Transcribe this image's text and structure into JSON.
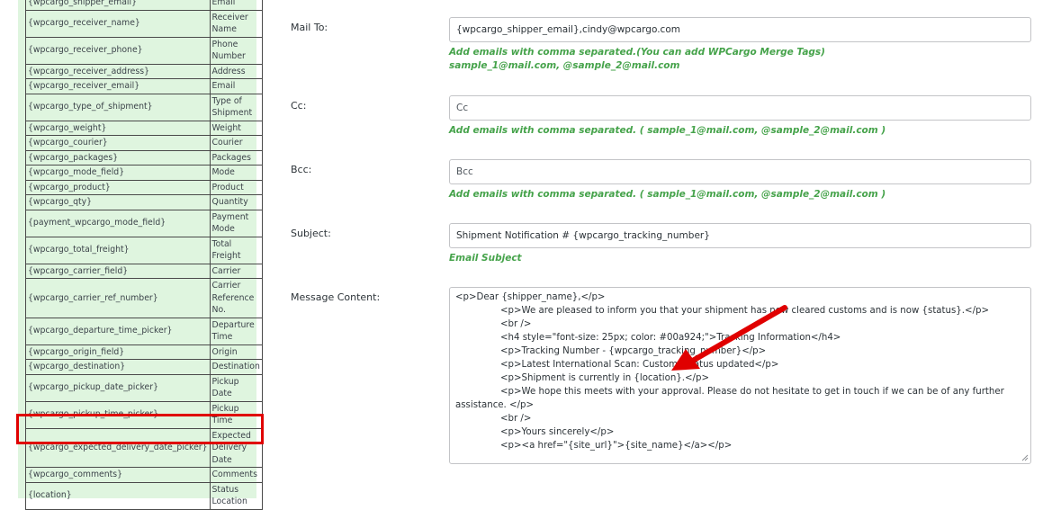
{
  "merge_tags": [
    {
      "tag": "{wpcargo_shipper_email}",
      "label": "Email"
    },
    {
      "tag": "{wpcargo_receiver_name}",
      "label": "Receiver Name"
    },
    {
      "tag": "{wpcargo_receiver_phone}",
      "label": "Phone Number"
    },
    {
      "tag": "{wpcargo_receiver_address}",
      "label": "Address"
    },
    {
      "tag": "{wpcargo_receiver_email}",
      "label": "Email"
    },
    {
      "tag": "{wpcargo_type_of_shipment}",
      "label": "Type of Shipment"
    },
    {
      "tag": "{wpcargo_weight}",
      "label": "Weight"
    },
    {
      "tag": "{wpcargo_courier}",
      "label": "Courier"
    },
    {
      "tag": "{wpcargo_packages}",
      "label": "Packages"
    },
    {
      "tag": "{wpcargo_mode_field}",
      "label": "Mode"
    },
    {
      "tag": "{wpcargo_product}",
      "label": "Product"
    },
    {
      "tag": "{wpcargo_qty}",
      "label": "Quantity"
    },
    {
      "tag": "{payment_wpcargo_mode_field}",
      "label": "Payment Mode"
    },
    {
      "tag": "{wpcargo_total_freight}",
      "label": "Total Freight"
    },
    {
      "tag": "{wpcargo_carrier_field}",
      "label": "Carrier"
    },
    {
      "tag": "{wpcargo_carrier_ref_number}",
      "label": "Carrier Reference No."
    },
    {
      "tag": "{wpcargo_departure_time_picker}",
      "label": "Departure Time"
    },
    {
      "tag": "{wpcargo_origin_field}",
      "label": "Origin"
    },
    {
      "tag": "{wpcargo_destination}",
      "label": "Destination"
    },
    {
      "tag": "{wpcargo_pickup_date_picker}",
      "label": "Pickup Date"
    },
    {
      "tag": "{wpcargo_pickup_time_picker}",
      "label": "Pickup Time"
    },
    {
      "tag": "{wpcargo_expected_delivery_date_picker}",
      "label": "Expected Delivery Date"
    },
    {
      "tag": "{wpcargo_comments}",
      "label": "Comments"
    },
    {
      "tag": "{location}",
      "label": "Status Location"
    }
  ],
  "form": {
    "mail_to": {
      "label": "Mail To:",
      "value": "{wpcargo_shipper_email},cindy@wpcargo.com",
      "hint_line1": "Add emails with comma separated.(You can add WPCargo Merge Tags)",
      "hint_line2": "sample_1@mail.com, @sample_2@mail.com"
    },
    "cc": {
      "label": "Cc:",
      "placeholder": "Cc",
      "hint": "Add emails with comma separated. ( sample_1@mail.com, @sample_2@mail.com )"
    },
    "bcc": {
      "label": "Bcc:",
      "placeholder": "Bcc",
      "hint": "Add emails with comma separated. ( sample_1@mail.com, @sample_2@mail.com )"
    },
    "subject": {
      "label": "Subject:",
      "value": "Shipment Notification # {wpcargo_tracking_number}",
      "hint": "Email Subject"
    },
    "message": {
      "label": "Message Content:",
      "lines": [
        "<p>Dear {shipper_name},</p>",
        "<p>We are pleased to inform you that your shipment has now cleared customs and is now {status}.</p>",
        "<br />",
        "<h4 style=\"font-size: 25px; color: #00a924;\">Tracking Information</h4>",
        "<p>Tracking Number - {wpcargo_tracking_number}</p>",
        "<p>Latest International Scan: Customs status updated</p>",
        "<p>Shipment is currently in {location}.</p>",
        "<p>We hope this meets with your approval. Please do not hesitate to get in touch if we can be of any further assistance. </p>",
        "<br />",
        "<p>Yours sincerely</p>",
        "<p><a href=\"{site_url}\">{site_name}</a></p>"
      ]
    }
  },
  "colors": {
    "panel_bg": "#dff5df",
    "hint_green": "#46a34b",
    "highlight_red": "#e00000",
    "arrow_red": "#e00000"
  }
}
